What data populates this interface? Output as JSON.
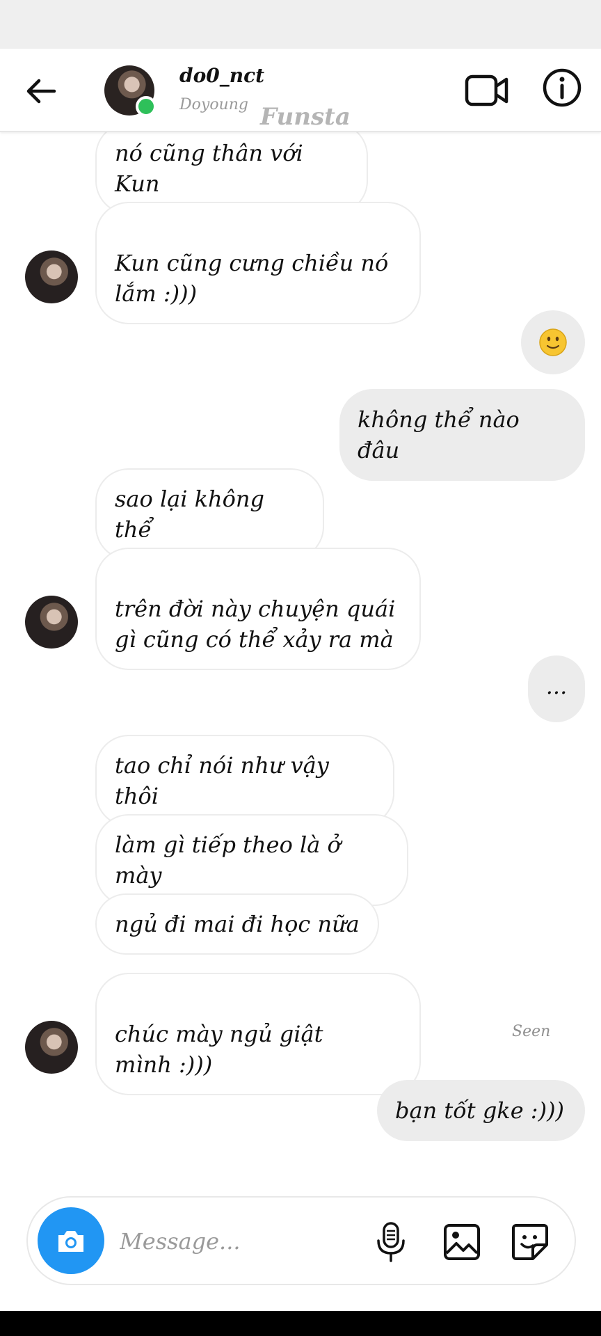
{
  "header": {
    "username": "do0_nct",
    "display_name": "Doyoung",
    "watermark": "Funsta",
    "online_color": "#2ec05a",
    "icons": [
      "back-arrow-icon",
      "video-call-icon",
      "info-icon"
    ]
  },
  "messages": [
    {
      "side": "received",
      "text": "nó cũng thân với Kun"
    },
    {
      "side": "received",
      "text": "Kun cũng cưng chiều nó\nlắm :)))"
    },
    {
      "side": "sent",
      "emoji": "slightly-smiling-face-icon"
    },
    {
      "side": "sent",
      "text": "không thể nào đâu"
    },
    {
      "side": "received",
      "text": "sao lại không thể"
    },
    {
      "side": "received",
      "text": "trên đời này chuyện quái\ngì cũng có thể xảy ra mà"
    },
    {
      "side": "sent",
      "text": "..."
    },
    {
      "side": "received",
      "text": "tao chỉ nói như vậy thôi"
    },
    {
      "side": "received",
      "text": "làm gì tiếp theo là ở mày"
    },
    {
      "side": "received",
      "text": "ngủ đi mai đi học nữa"
    },
    {
      "side": "received",
      "text": "chúc mày ngủ giật\nmình :)))"
    },
    {
      "side": "sent",
      "text": "bạn tốt gke :)))"
    }
  ],
  "seen_label": "Seen",
  "composer": {
    "placeholder": "Message...",
    "camera_color": "#2196f3",
    "icons": [
      "camera-icon",
      "microphone-icon",
      "image-icon",
      "sticker-icon"
    ]
  }
}
